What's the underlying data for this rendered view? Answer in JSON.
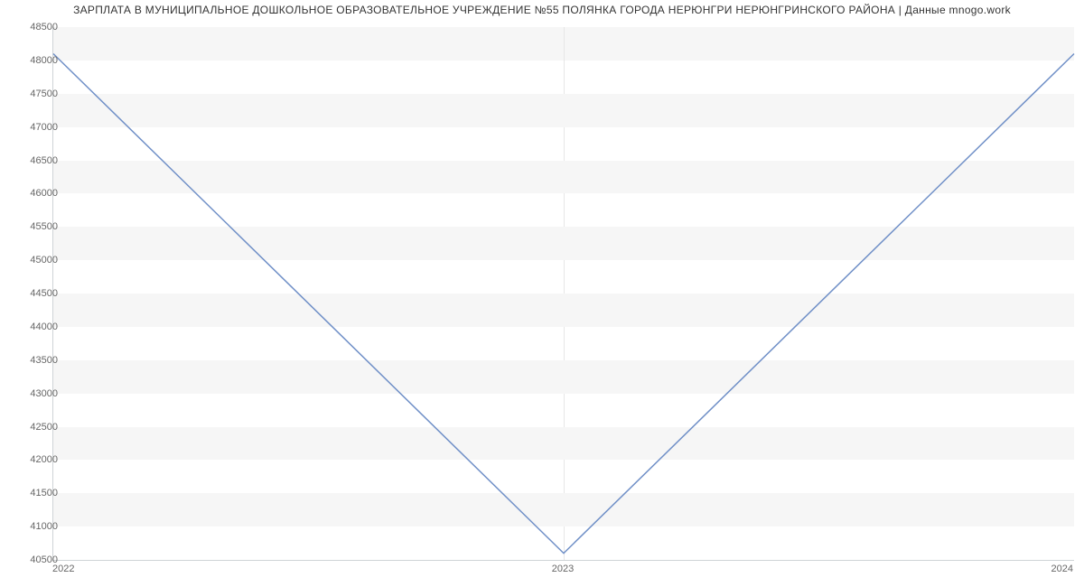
{
  "chart_data": {
    "type": "line",
    "title": "ЗАРПЛАТА В МУНИЦИПАЛЬНОЕ ДОШКОЛЬНОЕ ОБРАЗОВАТЕЛЬНОЕ УЧРЕЖДЕНИЕ №55 ПОЛЯНКА ГОРОДА НЕРЮНГРИ НЕРЮНГРИНСКОГО РАЙОНА | Данные mnogo.work",
    "xlabel": "",
    "ylabel": "",
    "x": [
      "2022",
      "2023",
      "2024"
    ],
    "values": [
      48100,
      40600,
      48100
    ],
    "ylim": [
      40500,
      48500
    ],
    "yticks": [
      40500,
      41000,
      41500,
      42000,
      42500,
      43000,
      43500,
      44000,
      44500,
      45000,
      45500,
      46000,
      46500,
      47000,
      47500,
      48000,
      48500
    ],
    "line_color": "#6f8fc7",
    "band_color": "#f6f6f6"
  }
}
